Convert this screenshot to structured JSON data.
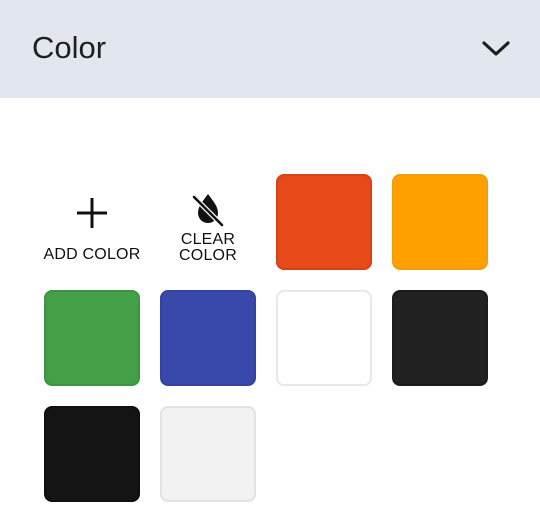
{
  "panel": {
    "title": "Color",
    "toggle_icon": "chevron-down-icon"
  },
  "actions": {
    "add_label": "ADD COLOR",
    "add_icon": "plus-icon",
    "clear_label_line1": "CLEAR",
    "clear_label_line2": "COLOR",
    "clear_icon": "no-fill-drop-icon"
  },
  "swatches": [
    {
      "name": "orange-red",
      "color": "#e64a19",
      "border": "#d84315"
    },
    {
      "name": "orange",
      "color": "#ffa000",
      "border": "#f39c12"
    },
    {
      "name": "green",
      "color": "#43a047",
      "border": "#3d9541"
    },
    {
      "name": "blue",
      "color": "#3949ab",
      "border": "#3443a0"
    },
    {
      "name": "white",
      "color": "#ffffff",
      "border": "#e8e8e8"
    },
    {
      "name": "dark-gray",
      "color": "#212121",
      "border": "#1c1c1c"
    },
    {
      "name": "black",
      "color": "#141414",
      "border": "#101010"
    },
    {
      "name": "light-gray",
      "color": "#f2f2f2",
      "border": "#e2e2e2"
    }
  ]
}
